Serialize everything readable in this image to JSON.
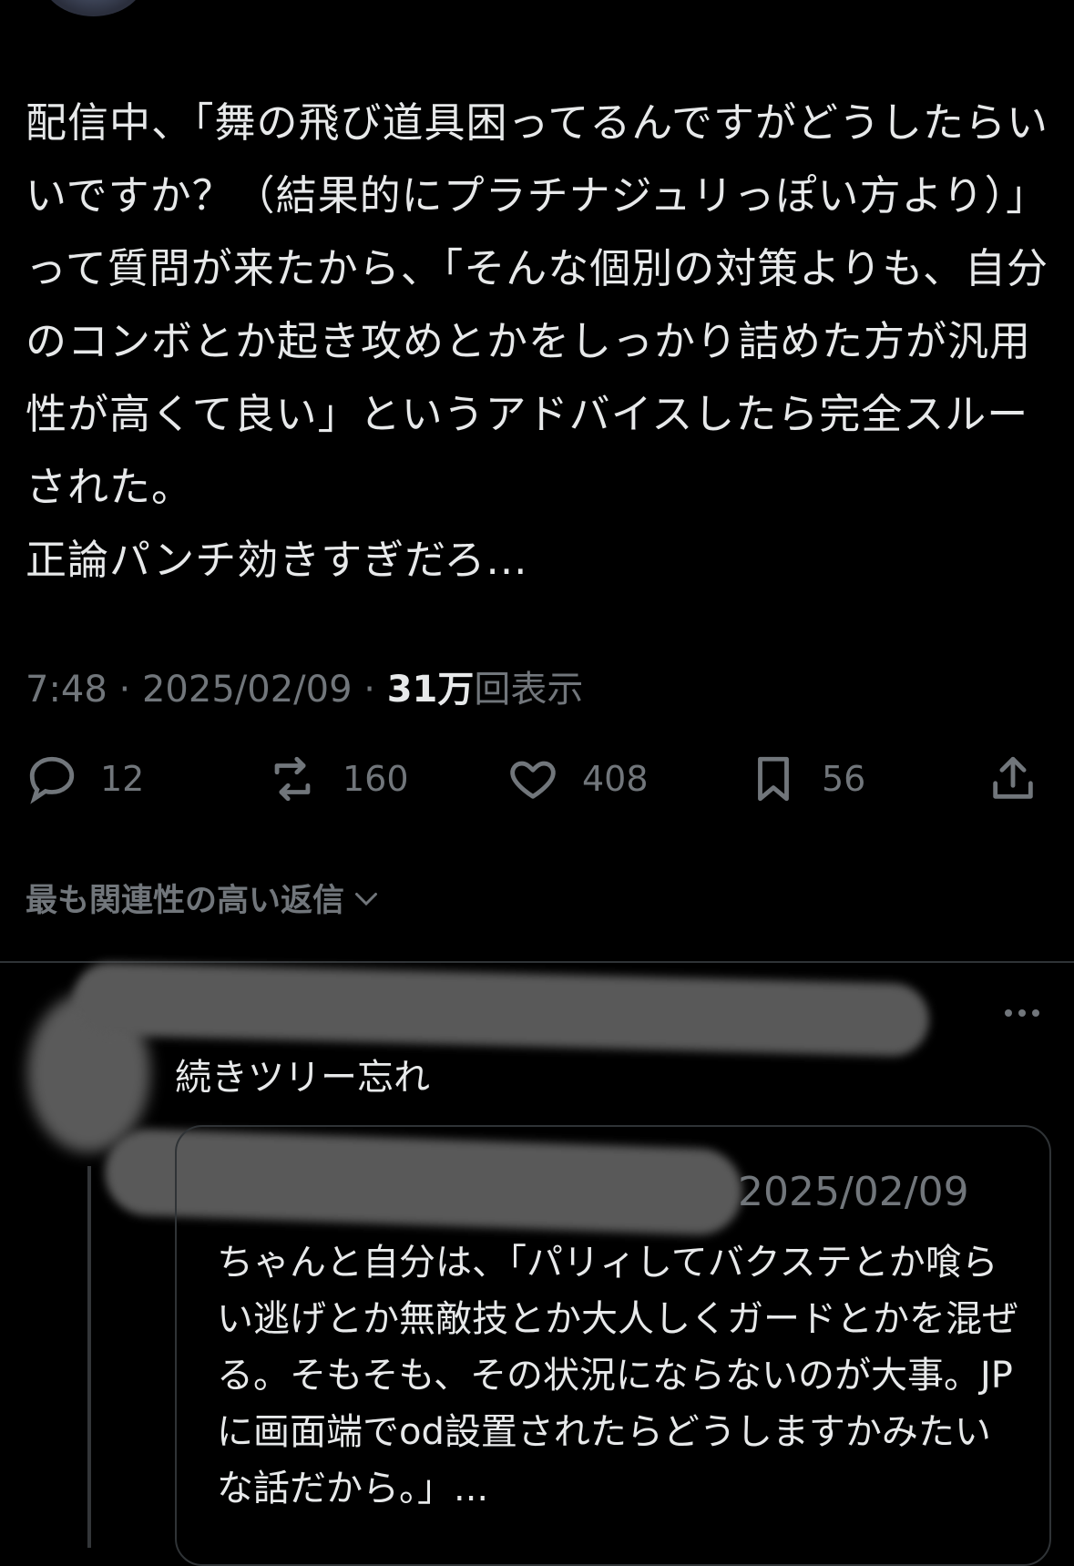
{
  "post": {
    "body": "配信中、「舞の飛び道具困ってるんですがどうしたらいいですか？（結果的にプラチナジュリっぽい方より）」って質問が来たから、「そんな個別の対策よりも、自分のコンボとか起き攻めとかをしっかり詰めた方が汎用性が高くて良い」というアドバイスしたら完全スルーされた。\n正論パンチ効きすぎだろ...",
    "time": "7:48",
    "date": "2025/02/09",
    "views_count": "31万",
    "views_label": "回表示"
  },
  "actions": {
    "replies": "12",
    "reposts": "160",
    "likes": "408",
    "bookmarks": "56"
  },
  "sort_label": "最も関連性の高い返信",
  "reply": {
    "text": "続きツリー忘れ",
    "quote": {
      "date": "2025/02/09",
      "text": "ちゃんと自分は、「パリィしてバクステとか喰らい逃げとか無敵技とか大人しくガードとかを混ぜる。そもそも、その状況にならないのが大事。JPに画面端でod設置されたらどうしますかみたいな話だから。」..."
    }
  },
  "colors": {
    "background": "#000000",
    "text": "#e7e9ea",
    "muted": "#71767b",
    "divider": "#2f3336"
  },
  "icons": [
    "reply-icon",
    "repost-icon",
    "like-icon",
    "bookmark-icon",
    "share-icon",
    "chevron-down-icon",
    "more-icon"
  ]
}
